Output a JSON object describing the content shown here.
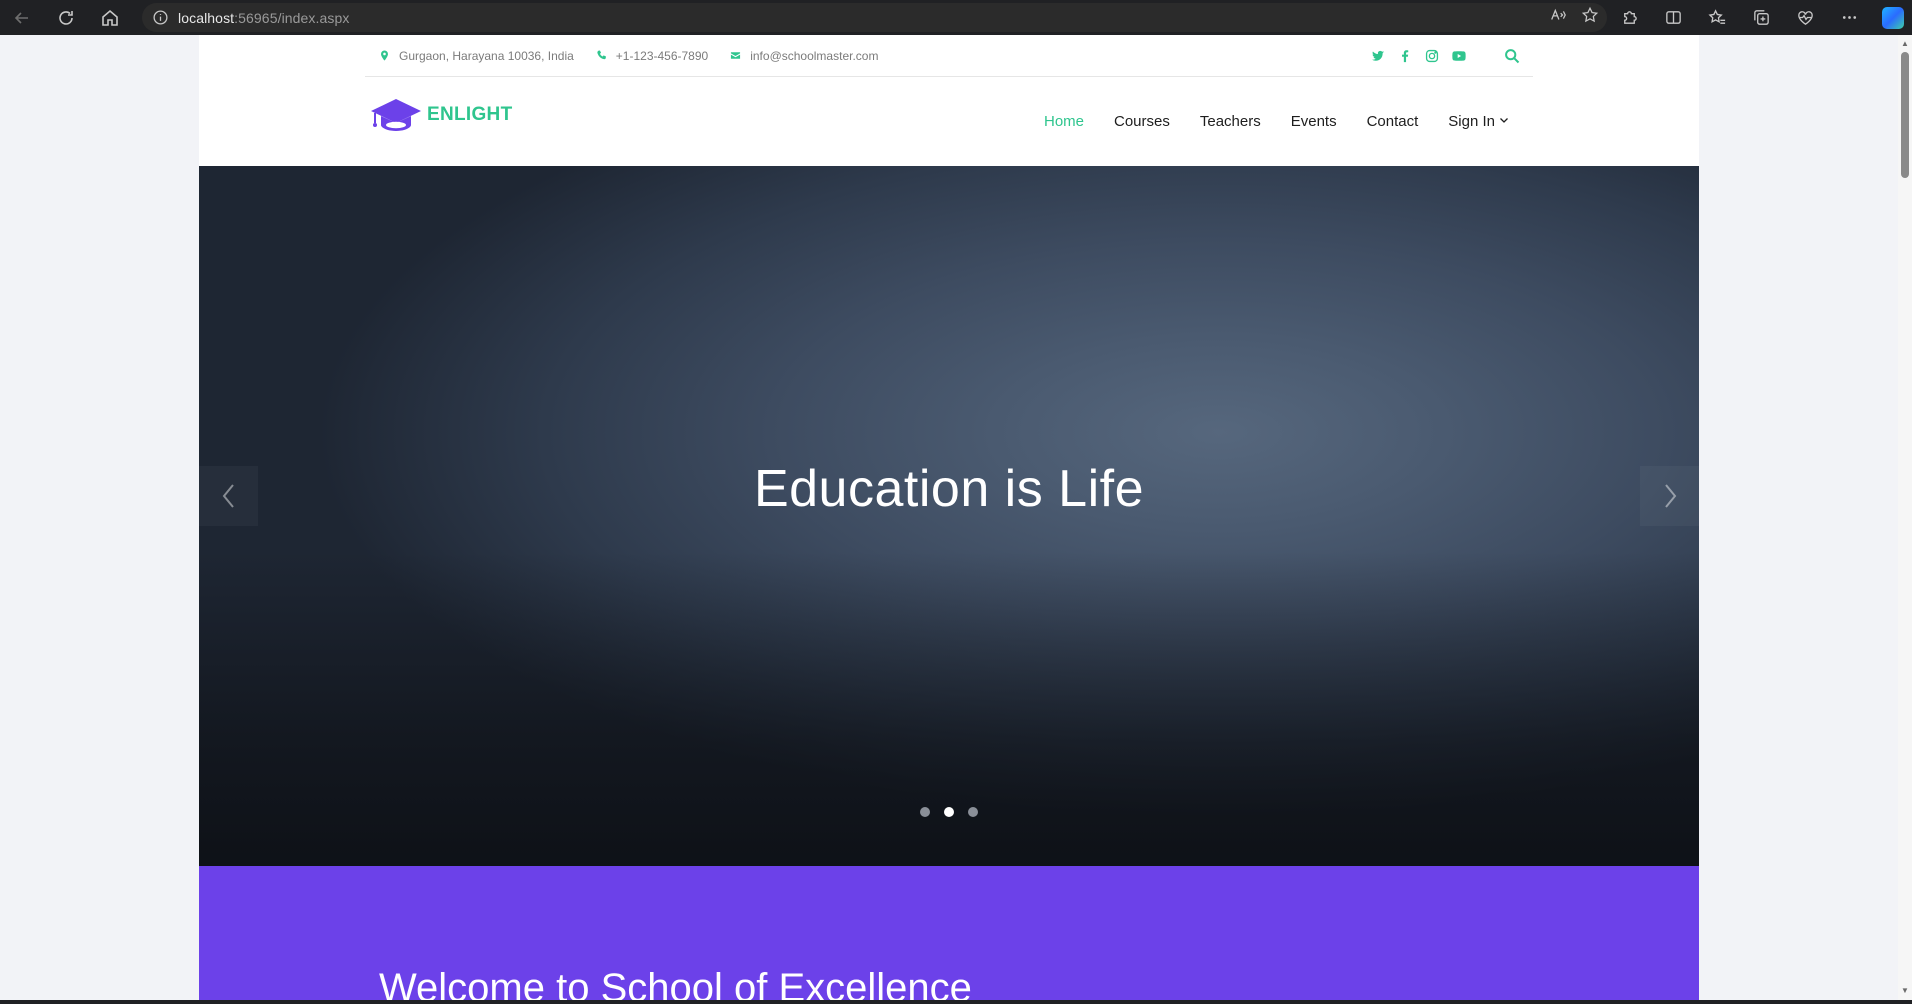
{
  "browser": {
    "url_host": "localhost",
    "url_rest": ":56965/index.aspx"
  },
  "topbar": {
    "address": "Gurgaon, Harayana 10036, India",
    "phone": "+1-123-456-7890",
    "email": "info@schoolmaster.com",
    "social_icons": [
      "twitter-icon",
      "facebook-icon",
      "instagram-icon",
      "youtube-icon"
    ]
  },
  "brand": {
    "name": "ENLIGHT",
    "accent_color": "#2fc58e",
    "logo_color": "#6c41e9"
  },
  "nav": {
    "items": [
      {
        "label": "Home",
        "active": true
      },
      {
        "label": "Courses",
        "active": false
      },
      {
        "label": "Teachers",
        "active": false
      },
      {
        "label": "Events",
        "active": false
      },
      {
        "label": "Contact",
        "active": false
      },
      {
        "label": "Sign In",
        "active": false,
        "has_dropdown": true
      }
    ]
  },
  "hero": {
    "title": "Education is Life",
    "slides_total": 3,
    "active_slide": 2
  },
  "welcome": {
    "title": "Welcome to School of Excellence",
    "bg_color": "#6c41e9"
  }
}
